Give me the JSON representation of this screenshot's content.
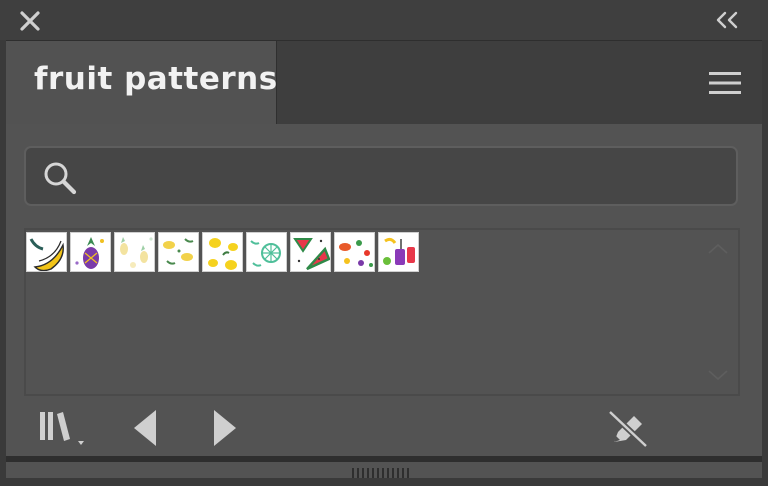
{
  "window": {
    "close_icon": "close-icon",
    "collapse_icon": "double-chevron-left-icon"
  },
  "tab": {
    "label": "fruit patterns",
    "menu_icon": "hamburger-menu-icon"
  },
  "search": {
    "icon": "search-icon",
    "value": "",
    "placeholder": ""
  },
  "swatches": [
    {
      "icon": "banana-pattern-swatch"
    },
    {
      "icon": "pineapple-pattern-swatch"
    },
    {
      "icon": "pale-pineapple-pattern-swatch"
    },
    {
      "icon": "lemon-leaf-pattern-swatch"
    },
    {
      "icon": "lemon-pattern-swatch"
    },
    {
      "icon": "citrus-slice-pattern-swatch"
    },
    {
      "icon": "watermelon-pattern-swatch"
    },
    {
      "icon": "mixed-fruit-pattern-swatch"
    },
    {
      "icon": "fruit-drink-pattern-swatch"
    }
  ],
  "toolbar": {
    "library_icon": "swatch-libraries-menu-icon",
    "prev_icon": "previous-triangle-icon",
    "next_icon": "next-triangle-icon",
    "break_link_icon": "break-link-pencil-icon"
  },
  "colors": {
    "panel_bg": "#535353",
    "titlebar_bg": "#3f3f3f",
    "text": "#f2f2f2"
  }
}
